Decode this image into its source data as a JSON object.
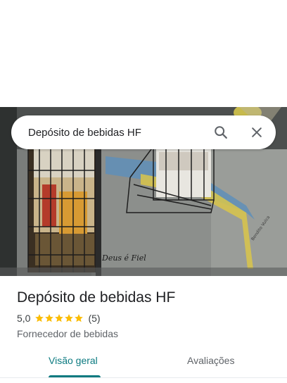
{
  "search": {
    "query": "Depósito de bebidas HF",
    "search_icon": "search-icon",
    "close_icon": "close-icon"
  },
  "photo": {
    "wall_text": "Deus é Fiel",
    "wall_text_small": "Bendito Vulca"
  },
  "place": {
    "name": "Depósito de bebidas HF",
    "rating_value": "5,0",
    "rating_stars": 5,
    "review_count": "(5)",
    "category": "Fornecedor de bebidas"
  },
  "tabs": {
    "overview": "Visão geral",
    "reviews": "Avaliações",
    "active": "overview"
  },
  "colors": {
    "accent": "#0b7a80",
    "star": "#fbbc04",
    "text_primary": "#202124",
    "text_secondary": "#5f6368"
  }
}
